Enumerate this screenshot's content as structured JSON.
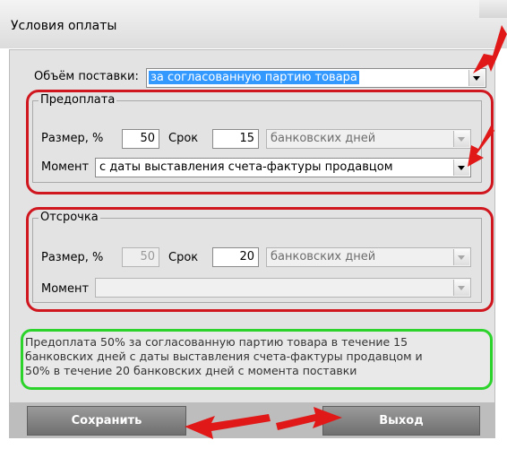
{
  "window": {
    "title": "Условия оплаты"
  },
  "delivery": {
    "label": "Объём поставки:",
    "value": "за согласованную партию товара"
  },
  "prepayment": {
    "group_label": "Предоплата",
    "size_label": "Размер, %",
    "size_value": "50",
    "term_label": "Срок",
    "term_value": "15",
    "days_type": "банковских дней",
    "moment_label": "Момент",
    "moment_value": "с даты выставления счета-фактуры продавцом"
  },
  "deferral": {
    "group_label": "Отсрочка",
    "size_label": "Размер, %",
    "size_value": "50",
    "term_label": "Срок",
    "term_value": "20",
    "days_type": "банковских дней",
    "moment_label": "Момент",
    "moment_value": ""
  },
  "summary": {
    "lines": [
      "Предоплата 50% за согласованную партию товара в течение 15",
      "банковских дней с даты выставления счета-фактуры продавцом и",
      "50% в течение 20 банковских дней с момента поставки"
    ]
  },
  "buttons": {
    "save": "Сохранить",
    "exit": "Выход"
  },
  "colors": {
    "highlight_red": "#d0161e",
    "highlight_green": "#2bd32b",
    "selection": "#3399ff"
  }
}
